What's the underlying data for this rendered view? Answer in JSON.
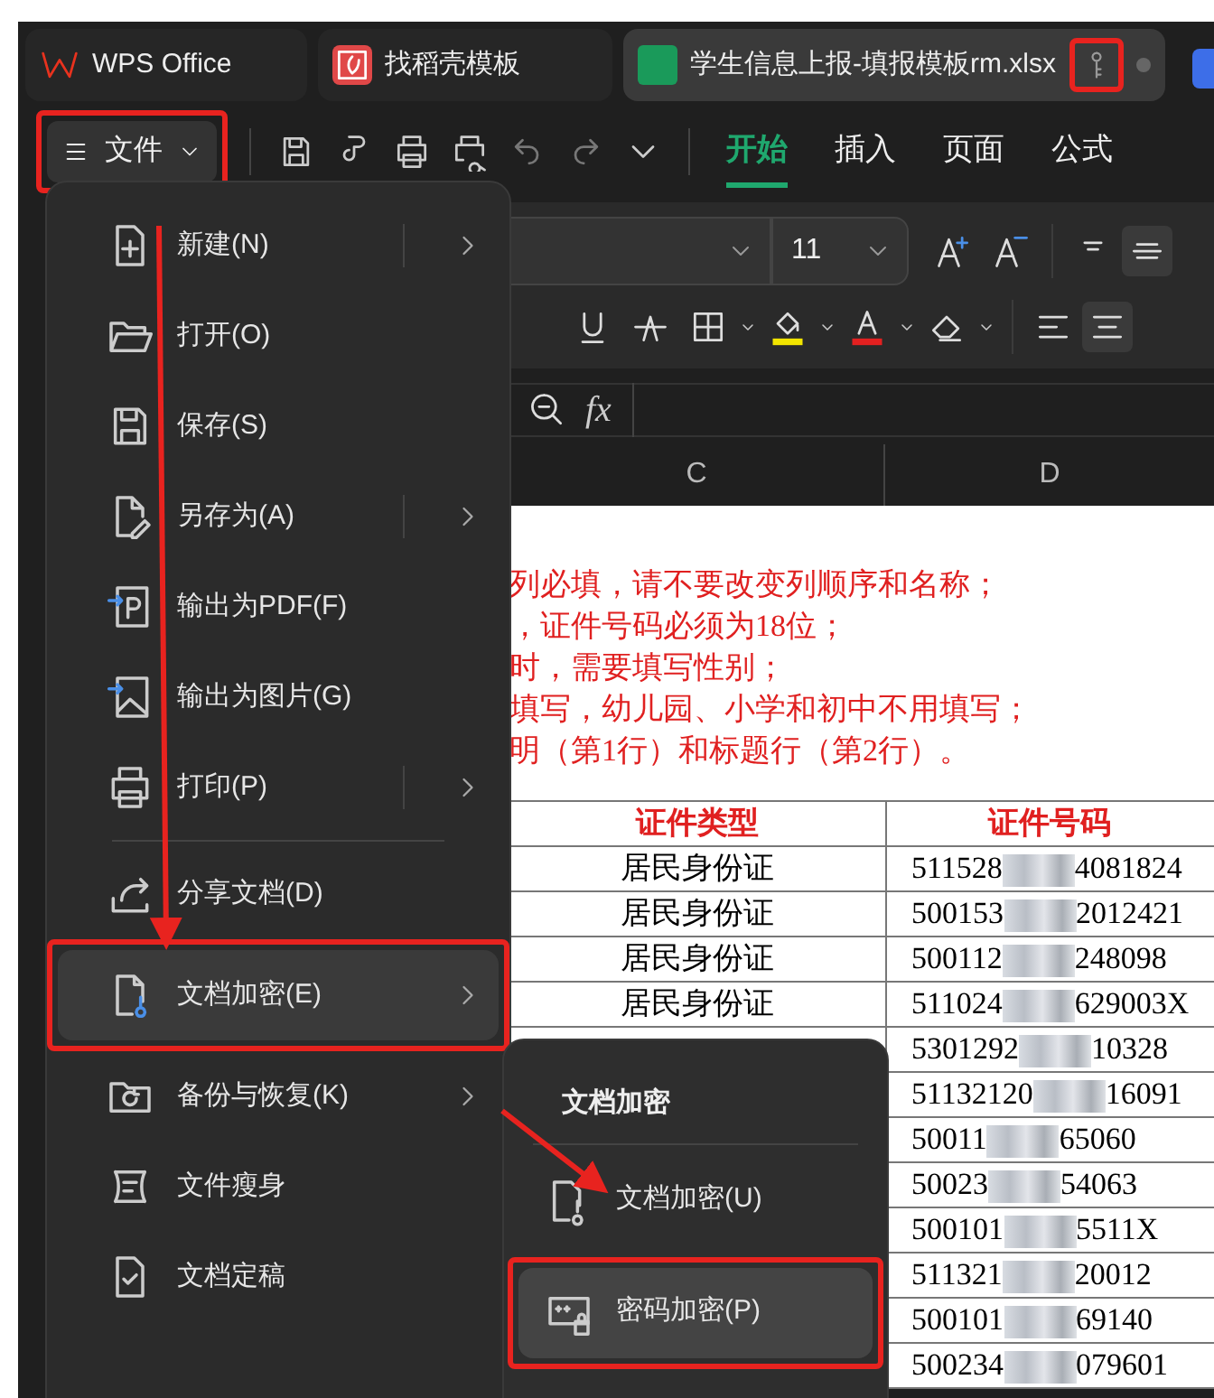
{
  "tabs": [
    {
      "kind": "home",
      "label": "WPS Office",
      "selected": false
    },
    {
      "kind": "template",
      "label": "找稻壳模板",
      "selected": false
    },
    {
      "kind": "sheet",
      "label": "学生信息上报-填报模板rm.xlsx",
      "selected": true,
      "key_highlighted": true
    }
  ],
  "file_button": {
    "label": "文件",
    "highlighted": true
  },
  "ribbon_tabs": [
    {
      "label": "开始",
      "selected": true
    },
    {
      "label": "插入",
      "selected": false
    },
    {
      "label": "页面",
      "selected": false
    },
    {
      "label": "公式",
      "selected": false
    }
  ],
  "font_size": "11",
  "formula_label": "fx",
  "columns": [
    "C",
    "D"
  ],
  "notes": [
    "列必填，请不要改变列顺序和名称；",
    "，证件号码必须为18位；",
    "时，需要填写性别；",
    "填写，幼儿园、小学和初中不用填写；",
    "明（第1行）和标题行（第2行）。"
  ],
  "table": {
    "headers": [
      "证件类型",
      "证件号码"
    ],
    "rows": [
      {
        "type": "居民身份证",
        "id_start": "511528",
        "id_end": "4081824"
      },
      {
        "type": "居民身份证",
        "id_start": "500153",
        "id_end": "2012421"
      },
      {
        "type": "居民身份证",
        "id_start": "500112",
        "id_end": "248098"
      },
      {
        "type": "居民身份证",
        "id_start": "511024",
        "id_end": "629003X"
      },
      {
        "id_start": "5301292",
        "id_end": "10328"
      },
      {
        "id_start": "51132120",
        "id_end": "16091"
      },
      {
        "id_start": "50011",
        "id_end": "65060"
      },
      {
        "id_start": "50023",
        "id_end": "54063"
      },
      {
        "id_start": "500101",
        "id_end": "5511X"
      },
      {
        "id_start": "511321",
        "id_end": "20012"
      },
      {
        "id_start": "500101",
        "id_end": "69140"
      },
      {
        "id_start": "500234",
        "id_end": "079601"
      }
    ]
  },
  "file_menu": {
    "items": [
      {
        "label": "新建(N)",
        "kind": "split",
        "selected": false,
        "highlighted": false
      },
      {
        "label": "打开(O)",
        "kind": "plain",
        "selected": false,
        "highlighted": false
      },
      {
        "label": "保存(S)",
        "kind": "plain",
        "selected": false,
        "highlighted": false
      },
      {
        "label": "另存为(A)",
        "kind": "split",
        "selected": false,
        "highlighted": false
      },
      {
        "label": "输出为PDF(F)",
        "kind": "plain",
        "selected": false,
        "highlighted": false
      },
      {
        "label": "输出为图片(G)",
        "kind": "plain",
        "selected": false,
        "highlighted": false
      },
      {
        "label": "打印(P)",
        "kind": "split",
        "selected": false,
        "highlighted": false
      },
      {
        "label": "分享文档(D)",
        "kind": "plain",
        "divider_before": true,
        "selected": false,
        "highlighted": false
      },
      {
        "label": "文档加密(E)",
        "kind": "submenu",
        "selected": true,
        "highlighted": true
      },
      {
        "label": "备份与恢复(K)",
        "kind": "submenu",
        "selected": false,
        "highlighted": false
      },
      {
        "label": "文件瘦身",
        "kind": "plain",
        "selected": false,
        "highlighted": false
      },
      {
        "label": "文档定稿",
        "kind": "plain",
        "selected": false,
        "highlighted": false
      }
    ]
  },
  "submenu": {
    "title": "文档加密",
    "items": [
      {
        "label": "文档加密(U)",
        "selected": false,
        "highlighted": false
      },
      {
        "label": "密码加密(P)",
        "selected": true,
        "highlighted": true
      }
    ]
  }
}
